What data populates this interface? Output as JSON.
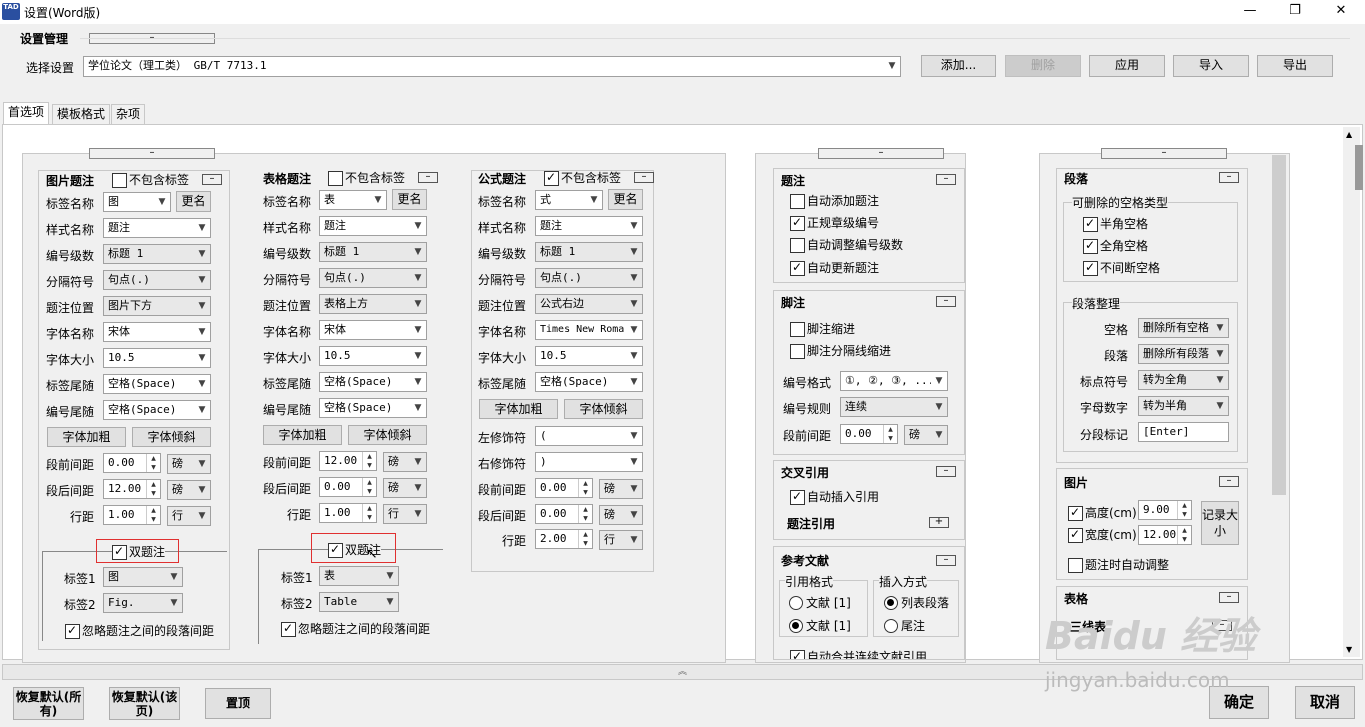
{
  "window": {
    "title": "设置(Word版)",
    "icon_text": "TAD",
    "minimize": "—",
    "restore": "❐",
    "close": "✕"
  },
  "settings": {
    "title": "设置管理",
    "choose_label": "选择设置",
    "choose_value": "学位论文（理工类） GB/T 7713.1",
    "buttons": [
      "添加...",
      "删除",
      "应用",
      "导入",
      "导出"
    ]
  },
  "tabs": [
    "首选项",
    "模板格式",
    "杂项"
  ],
  "figure": {
    "title": "图片题注",
    "no_label": "不包含标签",
    "rows": [
      [
        "标签名称",
        "图"
      ],
      [
        "样式名称",
        "题注"
      ],
      [
        "编号级数",
        "标题 1"
      ],
      [
        "分隔符号",
        "句点(.)"
      ],
      [
        "题注位置",
        "图片下方"
      ],
      [
        "字体名称",
        "宋体"
      ],
      [
        "字体大小",
        "10.5"
      ],
      [
        "标签尾随",
        "空格(Space)"
      ],
      [
        "编号尾随",
        "空格(Space)"
      ]
    ],
    "rename": "更名",
    "bold": "字体加粗",
    "italic": "字体倾斜",
    "spacing": [
      [
        "段前间距",
        "0.00",
        "磅"
      ],
      [
        "段后间距",
        "12.00",
        "磅"
      ],
      [
        "行距",
        "1.00",
        "行"
      ]
    ],
    "dual": "双题注",
    "tag1": [
      "标签1",
      "图"
    ],
    "tag2": [
      "标签2",
      "Fig."
    ],
    "ignore": "忽略题注之间的段落间距"
  },
  "table": {
    "title": "表格题注",
    "no_label": "不包含标签",
    "rows": [
      [
        "标签名称",
        "表"
      ],
      [
        "样式名称",
        "题注"
      ],
      [
        "编号级数",
        "标题 1"
      ],
      [
        "分隔符号",
        "句点(.)"
      ],
      [
        "题注位置",
        "表格上方"
      ],
      [
        "字体名称",
        "宋体"
      ],
      [
        "字体大小",
        "10.5"
      ],
      [
        "标签尾随",
        "空格(Space)"
      ],
      [
        "编号尾随",
        "空格(Space)"
      ]
    ],
    "rename": "更名",
    "bold": "字体加粗",
    "italic": "字体倾斜",
    "spacing": [
      [
        "段前间距",
        "12.00",
        "磅"
      ],
      [
        "段后间距",
        "0.00",
        "磅"
      ],
      [
        "行距",
        "1.00",
        "行"
      ]
    ],
    "dual": "双题注",
    "tag1": [
      "标签1",
      "表"
    ],
    "tag2": [
      "标签2",
      "Table"
    ],
    "ignore": "忽略题注之间的段落间距"
  },
  "formula": {
    "title": "公式题注",
    "no_label": "不包含标签",
    "rows": [
      [
        "标签名称",
        "式"
      ],
      [
        "样式名称",
        "题注"
      ],
      [
        "编号级数",
        "标题 1"
      ],
      [
        "分隔符号",
        "句点(.)"
      ],
      [
        "题注位置",
        "公式右边"
      ],
      [
        "字体名称",
        "Times New Roma"
      ],
      [
        "字体大小",
        "10.5"
      ],
      [
        "标签尾随",
        "空格(Space)"
      ]
    ],
    "rename": "更名",
    "bold": "字体加粗",
    "italic": "字体倾斜",
    "decor": [
      [
        "左修饰符",
        "("
      ],
      [
        "右修饰符",
        ")"
      ]
    ],
    "spacing": [
      [
        "段前间距",
        "0.00",
        "磅"
      ],
      [
        "段后间距",
        "0.00",
        "磅"
      ],
      [
        "行距",
        "2.00",
        "行"
      ]
    ]
  },
  "caption": {
    "title": "题注",
    "items": [
      "自动添加题注",
      "正规章级编号",
      "自动调整编号级数",
      "自动更新题注"
    ]
  },
  "footnote": {
    "title": "脚注",
    "items": [
      "脚注缩进",
      "脚注分隔线缩进"
    ],
    "fmt_label": "编号格式",
    "fmt_value": "①, ②, ③, ...",
    "rule_label": "编号规则",
    "rule_value": "连续",
    "space_label": "段前间距",
    "space_value": "0.00",
    "space_unit": "磅"
  },
  "crossref": {
    "title": "交叉引用",
    "item": "自动插入引用",
    "sub": "题注引用"
  },
  "refs": {
    "title": "参考文献",
    "cite_fmt": "引用格式",
    "opt1": "文献 [1]",
    "opt2": "文献 [1]",
    "insert": "插入方式",
    "ins1": "列表段落",
    "ins2": "尾注",
    "auto_merge": "自动合并连续文献引用"
  },
  "para": {
    "title": "段落",
    "space_types": "可删除的空格类型",
    "half": "半角空格",
    "full": "全角空格",
    "nbsp": "不间断空格",
    "cleanup": "段落整理",
    "rows": [
      [
        "空格",
        "删除所有空格"
      ],
      [
        "段落",
        "删除所有段落"
      ],
      [
        "标点符号",
        "转为全角"
      ],
      [
        "字母数字",
        "转为半角"
      ]
    ],
    "mark_label": "分段标记",
    "mark_value": "[Enter]"
  },
  "image": {
    "title": "图片",
    "height_label": "高度(cm)",
    "height_value": "9.00",
    "width_label": "宽度(cm)",
    "width_value": "12.00",
    "record": "记录大小",
    "auto": "题注时自动调整"
  },
  "tblsec": {
    "title": "表格",
    "sub": "三线表"
  },
  "bottom": {
    "reset_all": "恢复默认(所有)",
    "reset_page": "恢复默认(该页)",
    "top": "置顶",
    "ok": "确定",
    "cancel": "取消"
  },
  "watermark": {
    "brand": "Baidu 经验",
    "url": "jingyan.baidu.com"
  }
}
